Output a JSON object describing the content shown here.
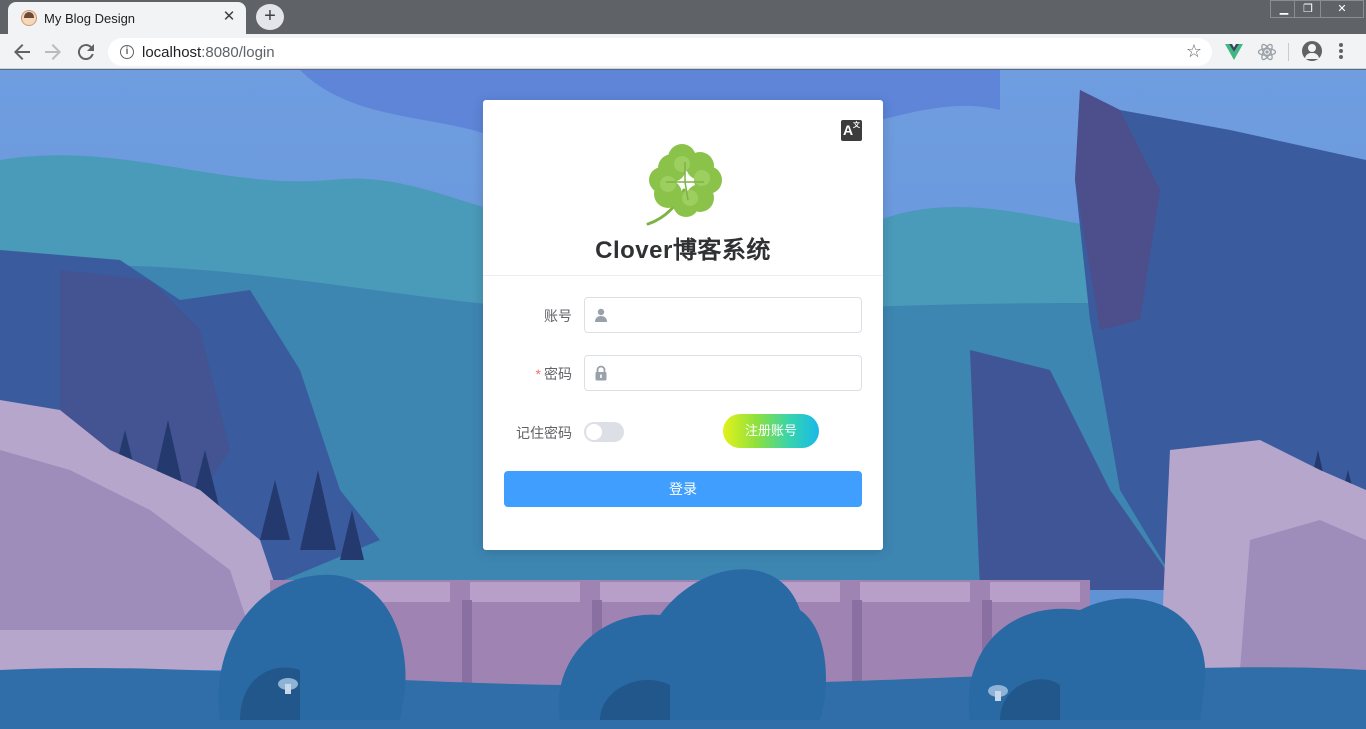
{
  "browser": {
    "tab_title": "My Blog Design",
    "tab_close": "✕",
    "new_tab": "+",
    "url_host": "localhost",
    "url_path": ":8080/login",
    "window_min": "▁",
    "window_max": "❐",
    "window_close": "✕"
  },
  "icons": {
    "back": "back-arrow-icon",
    "forward": "forward-arrow-icon",
    "reload": "reload-icon",
    "info": "info-icon",
    "star": "star-icon",
    "translate": "translate-icon",
    "user": "user-icon",
    "lock": "lock-icon"
  },
  "login": {
    "title": "Clover博客系统",
    "account_label": "账号",
    "password_label": "密码",
    "required_mark": "*",
    "account_value": "",
    "password_value": "",
    "remember_label": "记住密码",
    "remember_checked": false,
    "register_button": "注册账号",
    "login_button": "登录"
  },
  "colors": {
    "primary": "#409eff",
    "required": "#f56c6c",
    "clover": "#8bc34a"
  }
}
